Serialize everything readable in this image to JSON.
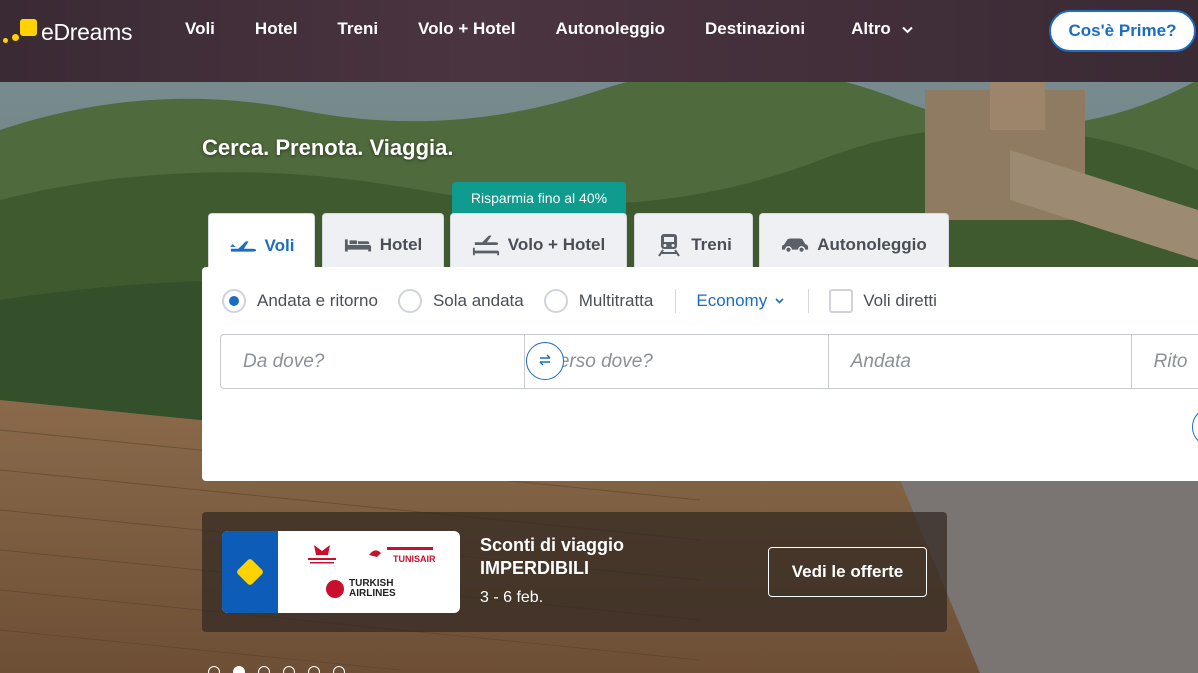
{
  "brand": {
    "name": "eDreams",
    "accent": "#ffd200",
    "link_color": "#1b6dc1",
    "promo_color": "#0f9b8e"
  },
  "nav": {
    "items": [
      {
        "label": "Voli"
      },
      {
        "label": "Hotel"
      },
      {
        "label": "Treni"
      },
      {
        "label": "Volo + Hotel"
      },
      {
        "label": "Autonoleggio"
      },
      {
        "label": "Destinazioni"
      },
      {
        "label": "Altro",
        "icon": "chevron-down-icon"
      }
    ],
    "prime_button": "Cos'è Prime?"
  },
  "hero": {
    "tagline": "Cerca. Prenota. Viaggia.",
    "promo_badge": "Risparmia fino al 40%"
  },
  "search": {
    "tabs": [
      {
        "label": "Voli",
        "icon": "plane-icon",
        "active": true
      },
      {
        "label": "Hotel",
        "icon": "bed-icon",
        "active": false
      },
      {
        "label": "Volo + Hotel",
        "icon": "flight-hotel-icon",
        "active": false
      },
      {
        "label": "Treni",
        "icon": "train-icon",
        "active": false
      },
      {
        "label": "Autonoleggio",
        "icon": "car-icon",
        "active": false
      }
    ],
    "trip_types": [
      {
        "label": "Andata e ritorno",
        "checked": true
      },
      {
        "label": "Sola andata",
        "checked": false
      },
      {
        "label": "Multitratta",
        "checked": false
      }
    ],
    "cabin_class": "Economy",
    "direct_flights": {
      "label": "Voli diretti",
      "checked": false
    },
    "fields": {
      "origin_placeholder": "Da dove?",
      "destination_placeholder": "Verso dove?",
      "departure_placeholder": "Andata",
      "return_placeholder": "Rito"
    }
  },
  "banner": {
    "title_line1": "Sconti di viaggio",
    "title_line2": "IMPERDIBILI",
    "dates": "3 - 6 feb.",
    "button": "Vedi le offerte",
    "airlines": {
      "tunisair": "TUNISAIR",
      "turkish_line1": "TURKISH",
      "turkish_line2": "AIRLINES"
    }
  },
  "carousel": {
    "total": 6,
    "active_index": 1
  }
}
